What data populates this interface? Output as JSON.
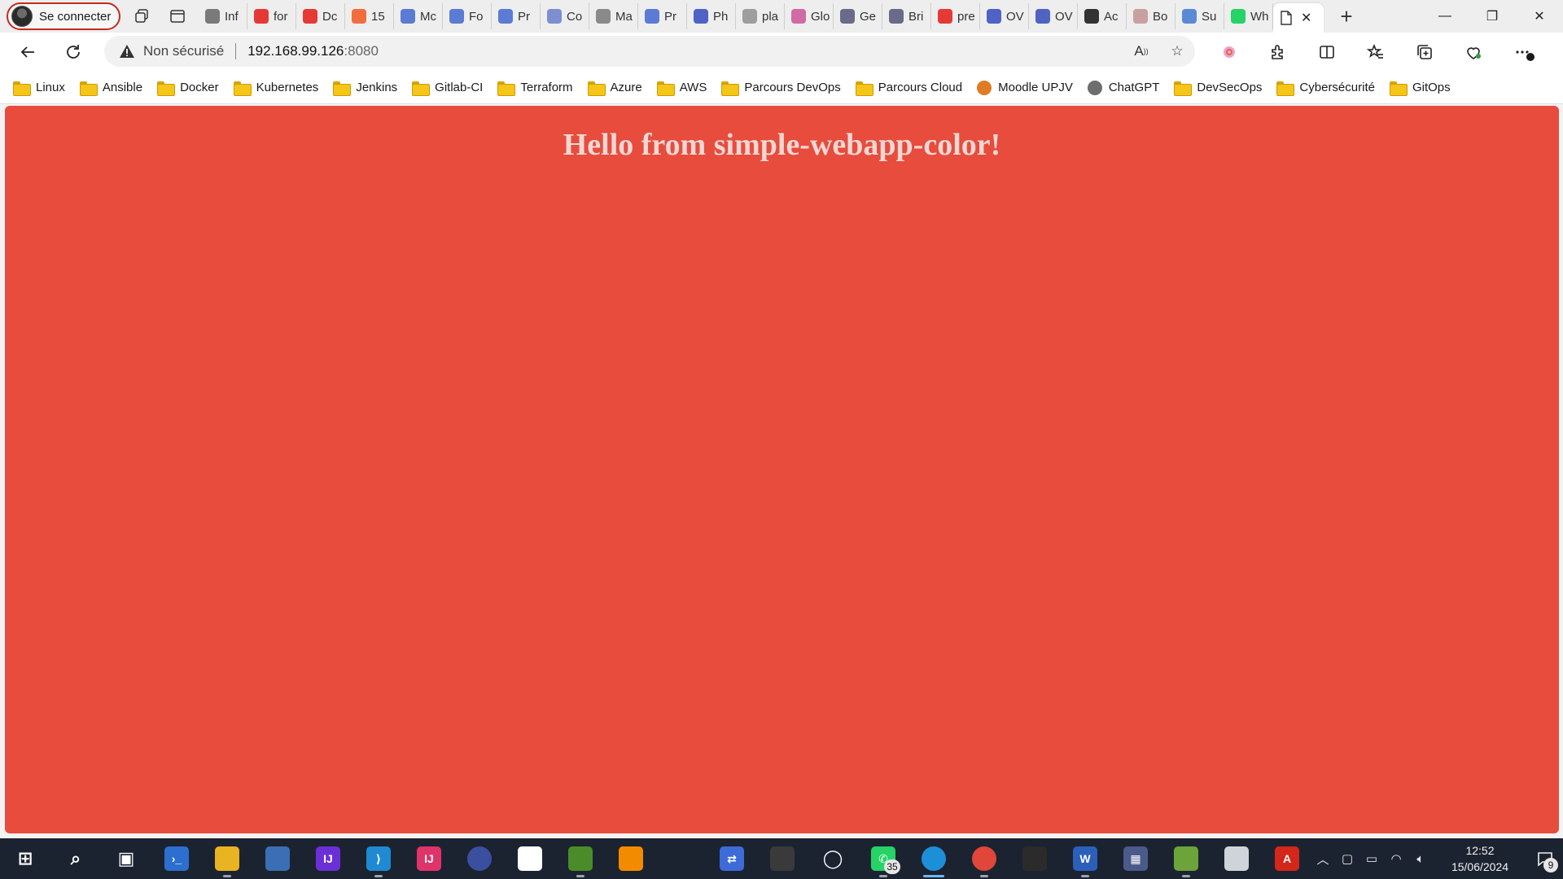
{
  "browser": {
    "profile_label": "Se connecter",
    "tabs": [
      {
        "label": "Inf",
        "icon": "plus-square-icon",
        "color": "#7a7a7a"
      },
      {
        "label": "for",
        "icon": "youtube-icon",
        "color": "#e53935"
      },
      {
        "label": "Dc",
        "icon": "youtube-icon",
        "color": "#e53935"
      },
      {
        "label": "15",
        "icon": "gitlab-icon",
        "color": "#f26d3d"
      },
      {
        "label": "Mc",
        "icon": "copilot-icon",
        "color": "#5b7bd5"
      },
      {
        "label": "Fo",
        "icon": "copilot-icon",
        "color": "#5b7bd5"
      },
      {
        "label": "Pr",
        "icon": "copilot-icon",
        "color": "#5b7bd5"
      },
      {
        "label": "Co",
        "icon": "gear-icon",
        "color": "#7d8fd0"
      },
      {
        "label": "Ma",
        "icon": "xe-icon",
        "color": "#8a8a8a"
      },
      {
        "label": "Pr",
        "icon": "copilot-icon",
        "color": "#5b7bd5"
      },
      {
        "label": "Ph",
        "icon": "ovh-icon",
        "color": "#4e63c4"
      },
      {
        "label": "pla",
        "icon": "google-icon",
        "color": "#9e9e9e"
      },
      {
        "label": "Glo",
        "icon": "loop-icon",
        "color": "#d16ba5"
      },
      {
        "label": "Ge",
        "icon": "apps-icon",
        "color": "#6a6a8a"
      },
      {
        "label": "Bri",
        "icon": "apps-icon",
        "color": "#6a6a8a"
      },
      {
        "label": "pre",
        "icon": "youtube-icon",
        "color": "#e53935"
      },
      {
        "label": "OV",
        "icon": "ovh-icon",
        "color": "#4e63c4"
      },
      {
        "label": "OV",
        "icon": "ovh-icon",
        "color": "#4e63c4"
      },
      {
        "label": "Ac",
        "icon": "b-icon",
        "color": "#333333"
      },
      {
        "label": "Bo",
        "icon": "gmail-icon",
        "color": "#c9a0a0"
      },
      {
        "label": "Su",
        "icon": "azure-icon",
        "color": "#5a8ad6"
      },
      {
        "label": "Wh",
        "icon": "whatsapp-icon",
        "color": "#25d366"
      }
    ],
    "address": {
      "insecure_label": "Non sécurisé",
      "host": "192.168.99.126",
      "port": ":8080"
    },
    "favorites": [
      {
        "label": "Linux",
        "icon": "folder-icon"
      },
      {
        "label": "Ansible",
        "icon": "folder-icon"
      },
      {
        "label": "Docker",
        "icon": "folder-icon"
      },
      {
        "label": "Kubernetes",
        "icon": "folder-icon"
      },
      {
        "label": "Jenkins",
        "icon": "folder-icon"
      },
      {
        "label": "Gitlab-CI",
        "icon": "folder-icon"
      },
      {
        "label": "Terraform",
        "icon": "folder-icon"
      },
      {
        "label": "Azure",
        "icon": "folder-icon"
      },
      {
        "label": "AWS",
        "icon": "folder-icon"
      },
      {
        "label": "Parcours DevOps",
        "icon": "folder-icon"
      },
      {
        "label": "Parcours Cloud",
        "icon": "folder-icon"
      },
      {
        "label": "Moodle UPJV",
        "icon": "moodle-icon"
      },
      {
        "label": "ChatGPT",
        "icon": "chatgpt-icon"
      },
      {
        "label": "DevSecOps",
        "icon": "folder-icon"
      },
      {
        "label": "Cybersécurité",
        "icon": "folder-icon"
      },
      {
        "label": "GitOps",
        "icon": "folder-icon"
      }
    ]
  },
  "page": {
    "heading": "Hello from simple-webapp-color!",
    "background_color": "#e74c3c"
  },
  "taskbar": {
    "apps": [
      {
        "icon": "windows-start-icon",
        "color": "#1c2330"
      },
      {
        "icon": "search-icon",
        "color": "#1c2330"
      },
      {
        "icon": "task-view-icon",
        "color": "#1c2330"
      },
      {
        "icon": "powershell-icon",
        "color": "#2c6fcf"
      },
      {
        "icon": "file-explorer-icon",
        "color": "#e8b422"
      },
      {
        "icon": "remote-desktop-icon",
        "color": "#3a6fb5"
      },
      {
        "icon": "intellij-icon",
        "color": "#6b2fd6"
      },
      {
        "icon": "vscode-icon",
        "color": "#1f8ad2"
      },
      {
        "icon": "intellij-icon",
        "color": "#e0336a"
      },
      {
        "icon": "eclipse-icon",
        "color": "#3b4fa0"
      },
      {
        "icon": "slack-icon",
        "color": "#ffffff"
      },
      {
        "icon": "mysql-workbench-icon",
        "color": "#4b8c2a"
      },
      {
        "icon": "vmware-icon",
        "color": "#f38b00"
      },
      {
        "icon": "virtualbox-icon",
        "color": "#1c2330"
      },
      {
        "icon": "network-icon",
        "color": "#3d6bd8"
      },
      {
        "icon": "snipping-tool-icon",
        "color": "#3a3a3a"
      },
      {
        "icon": "cortana-icon",
        "color": "#1c2330"
      },
      {
        "icon": "whatsapp-icon",
        "color": "#25d366",
        "badge": "35"
      },
      {
        "icon": "edge-icon",
        "color": "#1d8fd8"
      },
      {
        "icon": "chrome-icon",
        "color": "#e0463a"
      },
      {
        "icon": "app-icon",
        "color": "#2b2b2b"
      },
      {
        "icon": "word-icon",
        "color": "#2b5fba"
      },
      {
        "icon": "calculator-icon",
        "color": "#4a5a8a"
      },
      {
        "icon": "notepadpp-icon",
        "color": "#6ca33a"
      },
      {
        "icon": "printer-icon",
        "color": "#cfd4da"
      },
      {
        "icon": "acrobat-icon",
        "color": "#d4271c"
      }
    ],
    "time": "12:52",
    "date": "15/06/2024",
    "notification_count": "9"
  }
}
